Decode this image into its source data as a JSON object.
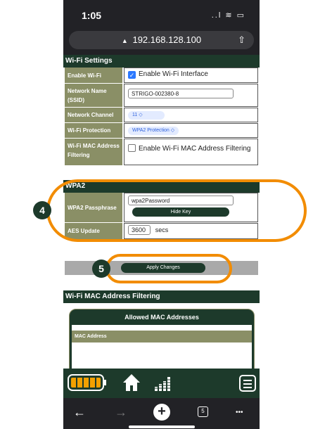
{
  "status_bar": {
    "time": "1:05",
    "icons": "..l ≋ ▭"
  },
  "url_bar": {
    "url": "192.168.128.100",
    "lock_glyph": "▲",
    "share_glyph": "⇧"
  },
  "wifi_settings": {
    "title": "Wi-Fi Settings",
    "enable_wifi": {
      "label": "Enable Wi-Fi",
      "checkbox_text": "Enable Wi-Fi Interface",
      "checked": true
    },
    "network_name": {
      "label": "Network Name (SSID)",
      "value": "STRIGO-002380-8"
    },
    "network_channel": {
      "label": "Network Channel",
      "value": "11 ◇"
    },
    "wifi_protection": {
      "label": "Wi-Fi Protection",
      "value": "WPA2 Protection ◇"
    },
    "mac_filter": {
      "label": "Wi-Fi MAC Address Filtering",
      "checkbox_text": "Enable Wi-Fi MAC Address Filtering",
      "checked": false
    }
  },
  "wpa2": {
    "title": "WPA2",
    "passphrase": {
      "label": "WPA2 Passphrase",
      "value": "wpa2Password",
      "hide_button": "Hide Key"
    },
    "aes_interval": {
      "label": "AES Update Interval",
      "value": "3600",
      "unit": "secs"
    }
  },
  "apply_button": "Apply Changes",
  "mac_filtering": {
    "title": "Wi-Fi MAC Address Filtering",
    "panel_title": "Allowed MAC Addresses",
    "column": "MAC Address"
  },
  "annotations": {
    "marker_4": "4",
    "marker_5": "5"
  },
  "colors": {
    "dark_green": "#1d3a2b",
    "olive": "#8a8f66",
    "highlight_orange": "#f28c00"
  },
  "browser_bar": {
    "back": "←",
    "forward": "→",
    "new_tab": "+",
    "tabs_count": "5",
    "more": "•••"
  }
}
